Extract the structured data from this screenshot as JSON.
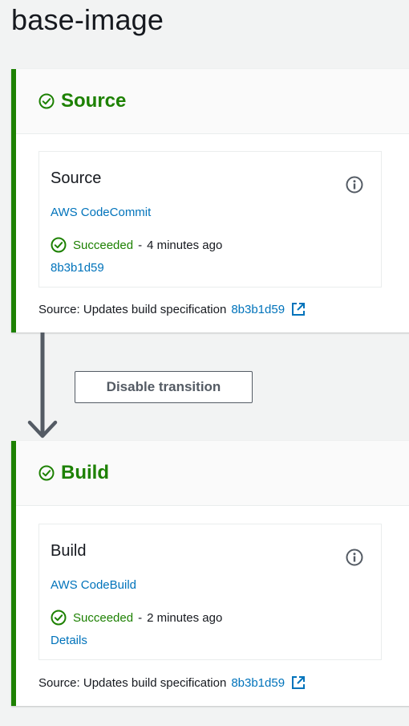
{
  "page": {
    "title": "base-image"
  },
  "stages": {
    "source": {
      "title": "Source",
      "action": {
        "name": "Source",
        "provider": "AWS CodeCommit",
        "status": "Succeeded",
        "separator": "-",
        "time": "4 minutes ago",
        "sub_link": "8b3b1d59"
      },
      "footer": {
        "label": "Source: Updates build specification",
        "commit": "8b3b1d59"
      }
    },
    "build": {
      "title": "Build",
      "action": {
        "name": "Build",
        "provider": "AWS CodeBuild",
        "status": "Succeeded",
        "separator": "-",
        "time": "2 minutes ago",
        "sub_link": "Details"
      },
      "footer": {
        "label": "Source: Updates build specification",
        "commit": "8b3b1d59"
      }
    }
  },
  "transition": {
    "button_label": "Disable transition"
  },
  "colors": {
    "success": "#1d8102",
    "link": "#0073bb",
    "text": "#16191f",
    "muted": "#545b64",
    "arrow": "#545b64"
  },
  "icons": {
    "stage_status": "check-circle-icon",
    "info": "info-icon",
    "external_link": "external-link-icon"
  }
}
